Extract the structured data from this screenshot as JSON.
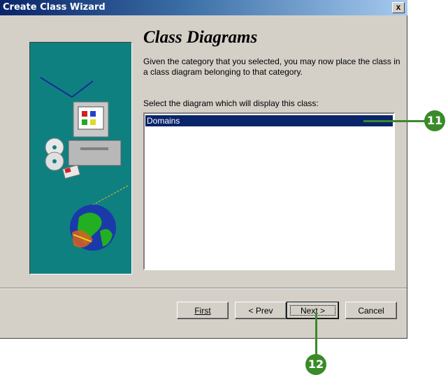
{
  "window": {
    "title": "Create Class Wizard",
    "close_label": "x"
  },
  "page": {
    "heading": "Class Diagrams",
    "description": "Given the category that you selected, you may now place the class in a class diagram belonging to that category.",
    "select_label": "Select the diagram which will display this class:"
  },
  "list": {
    "items": [
      "Domains"
    ],
    "selected_index": 0
  },
  "buttons": {
    "first": "First",
    "prev": "< Prev",
    "next": "Next >",
    "cancel": "Cancel"
  },
  "callouts": {
    "list": "11",
    "next": "12"
  },
  "colors": {
    "accent": "#0a246a",
    "art_bg": "#0f8080",
    "callout": "#3a8a2a"
  },
  "icons": [
    "computer-icon",
    "cd-icon",
    "globe-icon"
  ]
}
